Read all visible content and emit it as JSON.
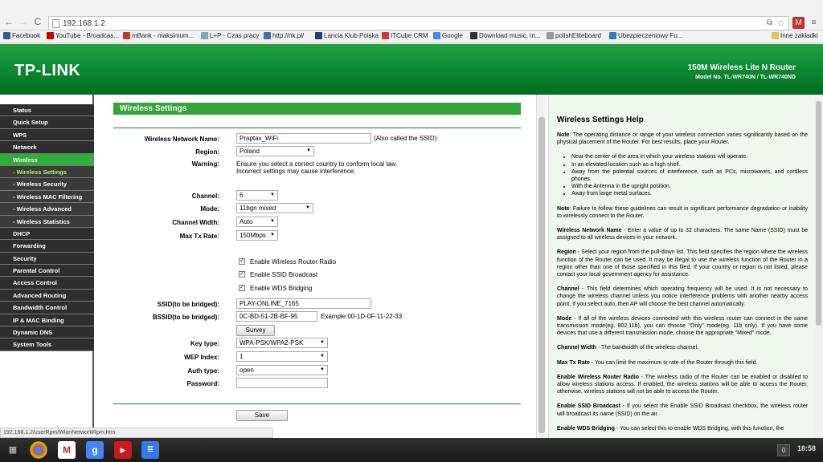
{
  "browser": {
    "url": "192.168.1.2",
    "bookmarks": [
      "Facebook",
      "YouTube - Broadcas...",
      "mBank - maksimum...",
      "L+P - Czas pracy",
      "http://nk.pl/",
      "Lancia Klub Polska",
      "ITCube CRM",
      "Google",
      "Download music, m...",
      "polishEliteboard",
      "Ubezpieczeniowy Fu...",
      "Inne zakładki"
    ],
    "status_url": "192.168.1.2/userRpm/WlanNetworkRpm.htm"
  },
  "header": {
    "logo": "TP-LINK",
    "product": "150M Wireless Lite N Router",
    "model": "Model No. TL-WR740N / TL-WR740ND"
  },
  "sidebar": {
    "items": [
      {
        "label": "Status",
        "type": "main"
      },
      {
        "label": "Quick Setup",
        "type": "main"
      },
      {
        "label": "WPS",
        "type": "main"
      },
      {
        "label": "Network",
        "type": "main"
      },
      {
        "label": "Wireless",
        "type": "active"
      },
      {
        "label": "- Wireless Settings",
        "type": "current"
      },
      {
        "label": "- Wireless Security",
        "type": "sub"
      },
      {
        "label": "- Wireless MAC Filtering",
        "type": "sub"
      },
      {
        "label": "- Wireless Advanced",
        "type": "sub"
      },
      {
        "label": "- Wireless Statistics",
        "type": "sub"
      },
      {
        "label": "DHCP",
        "type": "main"
      },
      {
        "label": "Forwarding",
        "type": "main"
      },
      {
        "label": "Security",
        "type": "main"
      },
      {
        "label": "Parental Control",
        "type": "main"
      },
      {
        "label": "Access Control",
        "type": "main"
      },
      {
        "label": "Advanced Routing",
        "type": "main"
      },
      {
        "label": "Bandwidth Control",
        "type": "main"
      },
      {
        "label": "IP & MAC Binding",
        "type": "main"
      },
      {
        "label": "Dynamic DNS",
        "type": "main"
      },
      {
        "label": "System Tools",
        "type": "main"
      }
    ]
  },
  "form": {
    "title": "Wireless Settings",
    "ssid_label": "Wireless Network Name:",
    "ssid_value": "Praptax_WiFi",
    "ssid_note": "(Also called the SSID)",
    "region_label": "Region:",
    "region_value": "Poland",
    "warning_label": "Warning:",
    "warning_text1": "Ensure you select a correct country to conform local law.",
    "warning_text2": "Incorrect settings may cause interference.",
    "channel_label": "Channel:",
    "channel_value": "6",
    "mode_label": "Mode:",
    "mode_value": "11bgn mixed",
    "width_label": "Channel Width:",
    "width_value": "Auto",
    "rate_label": "Max Tx Rate:",
    "rate_value": "150Mbps",
    "enable_radio": "Enable Wireless Router Radio",
    "enable_ssid": "Enable SSID Broadcast",
    "enable_wds": "Enable WDS Bridging",
    "bridged_ssid_label": "SSID(to be bridged):",
    "bridged_ssid_value": "PLAY-ONLINE_7165",
    "bssid_label": "BSSID(to be bridged):",
    "bssid_value": "0C-BD-51-2B-BF-95",
    "bssid_example": "Example:00-1D-0F-11-22-33",
    "survey": "Survey",
    "keytype_label": "Key type:",
    "keytype_value": "WPA-PSK/WPA2-PSK",
    "wepindex_label": "WEP Index:",
    "wepindex_value": "1",
    "authtype_label": "Auth type:",
    "authtype_value": "open",
    "password_label": "Password:",
    "password_value": "",
    "save": "Save"
  },
  "help": {
    "title": "Wireless Settings Help",
    "note1": "The operating distance or range of your wireless connection varies significantly based on the physical placement of the Router. For best results, place your Router.",
    "bullets": [
      "Near the center of the area in which your wireless stations will operate.",
      "In an elevated location such as a high shelf.",
      "Away from the potential sources of interference, such as PCs, microwaves, and cordless phones.",
      "With the Antenna in the upright position.",
      "Away from large metal surfaces."
    ],
    "note2": "Failure to follow these guidelines can result in significant performance degradation or inability to wirelessly connect to the Router.",
    "wnn": "Enter a value of up to 32 characters. The same Name (SSID) must be assigned to all wireless devices in your network.",
    "region": "Select your region from the pull-down list. This field specifies the region where the wireless function of the Router can be used. It may be illegal to use the wireless function of the Router in a region other than one of those specified in this filed. If your country or region is not listed, please contact your local government agency for assistance.",
    "channel": "This field determines which operating frequency will be used. It is not necessary to change the wireless channel unless you notice interference problems with another nearby access point. If you select auto, then AP will choose the best channel automatically.",
    "mode": "If all of the wireless devices connected with this wireless router can connect in the same transmission mode(eg. 802.11b), you can choose \"Only\" mode(eg. 11b only). If you have some devices that use a different transmission mode, choose the appropriate \"Mixed\" mode.",
    "cw": "The bandwidth of the wireless channel.",
    "mtr": "You can limit the maximum tx rate of the Router through this field.",
    "ewrr": "The wireless radio of the Router can be enabled or disabled to allow wireless stations access. If enabled, the wireless stations will be able to access the Router, otherwise, wireless stations will not be able to access the Router.",
    "esb": "If you select the Enable SSID Broadcast checkbox, the wireless router will broadcast its name (SSID) on the air.",
    "ewb": "You can select this to enable WDS Bridging, with this function, the"
  },
  "taskbar": {
    "badge": "0",
    "time": "18:58"
  }
}
